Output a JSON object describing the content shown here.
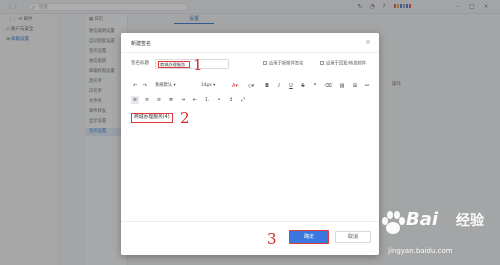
{
  "topbar": {
    "search_placeholder": "搜索",
    "user_colors": [
      "#e34b4b",
      "#f0a030",
      "#3a78e0",
      "#999999",
      "#3a78e0",
      "#e34b4b"
    ]
  },
  "leftnav": {
    "tab_mail": "邮件",
    "tab_settings": "设置",
    "items": [
      {
        "label": "账户与安全",
        "icon": "person-icon",
        "active": false
      },
      {
        "label": "邮箱设置",
        "icon": "mail-icon",
        "active": true
      }
    ]
  },
  "submenu": {
    "tab_calendar": "日历",
    "items": [
      {
        "label": "收信规则设置",
        "active": false
      },
      {
        "label": "自动回复设置",
        "active": false
      },
      {
        "label": "签名设置",
        "active": false
      },
      {
        "label": "收信规则",
        "active": false
      },
      {
        "label": "邮箱权限设置",
        "active": false
      },
      {
        "label": "黑名单",
        "active": false
      },
      {
        "label": "白名单",
        "active": false
      },
      {
        "label": "文件夹",
        "active": false
      },
      {
        "label": "邮件转发",
        "active": false
      },
      {
        "label": "显示设置",
        "active": false
      },
      {
        "label": "签名设置",
        "active": true
      }
    ]
  },
  "main": {
    "tab_label": "设置",
    "op_column": "操作"
  },
  "dialog": {
    "title": "新建签名",
    "name_label": "签名标题",
    "name_value": "商城办理服务",
    "check_new_mail": "应用于新邮件签名",
    "check_reply": "应用于回复/转发邮件",
    "font_family": "系统默认",
    "font_size": "14px",
    "signature_text": "商城办理服务(4)",
    "ok_label": "确定",
    "cancel_label": "取消"
  },
  "annotations": {
    "mark1": "1",
    "mark2": "2",
    "mark3": "3"
  },
  "watermark": {
    "brand": "Bai",
    "brand2": "经验",
    "url": "jingyan.baidu.com"
  },
  "colors": {
    "accent": "#3a78e0",
    "highlight_red": "#e03a3a"
  }
}
